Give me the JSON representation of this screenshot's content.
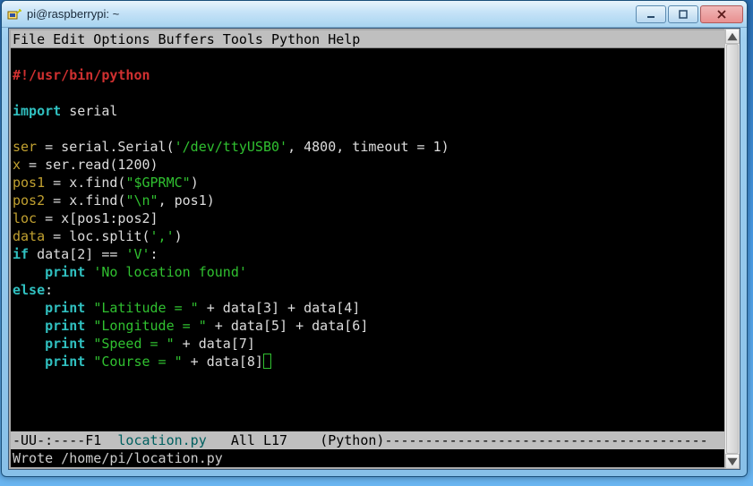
{
  "window": {
    "title": "pi@raspberrypi: ~",
    "controls": {
      "minimize": "minimize",
      "maximize": "maximize",
      "close": "close"
    }
  },
  "emacs": {
    "menubar": "File Edit Options Buffers Tools Python Help",
    "modeline_left": "-UU-:----F1  ",
    "modeline_file": "location.py",
    "modeline_mid": "   All L17    ",
    "modeline_mode": "(Python)",
    "modeline_dashes": "----------------------------------------",
    "minibuffer": "Wrote /home/pi/location.py"
  },
  "code": {
    "l1": "#!/usr/bin/python",
    "l2": "",
    "l3_kw": "import",
    "l3_mod": " serial",
    "l4": "",
    "l5_var": "ser",
    "l5_eq": " = serial.Serial(",
    "l5_str": "'/dev/ttyUSB0'",
    "l5_rest": ", 4800, timeout = 1)",
    "l6_var": "x",
    "l6_rest": " = ser.read(1200)",
    "l7_var": "pos1",
    "l7_mid": " = x.find(",
    "l7_str": "\"$GPRMC\"",
    "l7_end": ")",
    "l8_var": "pos2",
    "l8_mid": " = x.find(",
    "l8_str": "\"\\n\"",
    "l8_end": ", pos1)",
    "l9_var": "loc",
    "l9_rest": " = x[pos1:pos2]",
    "l10_var": "data",
    "l10_mid": " = loc.split(",
    "l10_str": "','",
    "l10_end": ")",
    "l11_kw": "if",
    "l11_mid": " data[2] == ",
    "l11_str": "'V'",
    "l11_end": ":",
    "l12_indent": "    ",
    "l12_kw": "print",
    "l12_sp": " ",
    "l12_str": "'No location found'",
    "l13_kw": "else",
    "l13_end": ":",
    "l14_indent": "    ",
    "l14_kw": "print",
    "l14_sp": " ",
    "l14_str": "\"Latitude = \"",
    "l14_rest": " + data[3] + data[4]",
    "l15_indent": "    ",
    "l15_kw": "print",
    "l15_sp": " ",
    "l15_str": "\"Longitude = \"",
    "l15_rest": " + data[5] + data[6]",
    "l16_indent": "    ",
    "l16_kw": "print",
    "l16_sp": " ",
    "l16_str": "\"Speed = \"",
    "l16_rest": " + data[7]",
    "l17_indent": "    ",
    "l17_kw": "print",
    "l17_sp": " ",
    "l17_str": "\"Course = \"",
    "l17_rest": " + data[8]"
  }
}
